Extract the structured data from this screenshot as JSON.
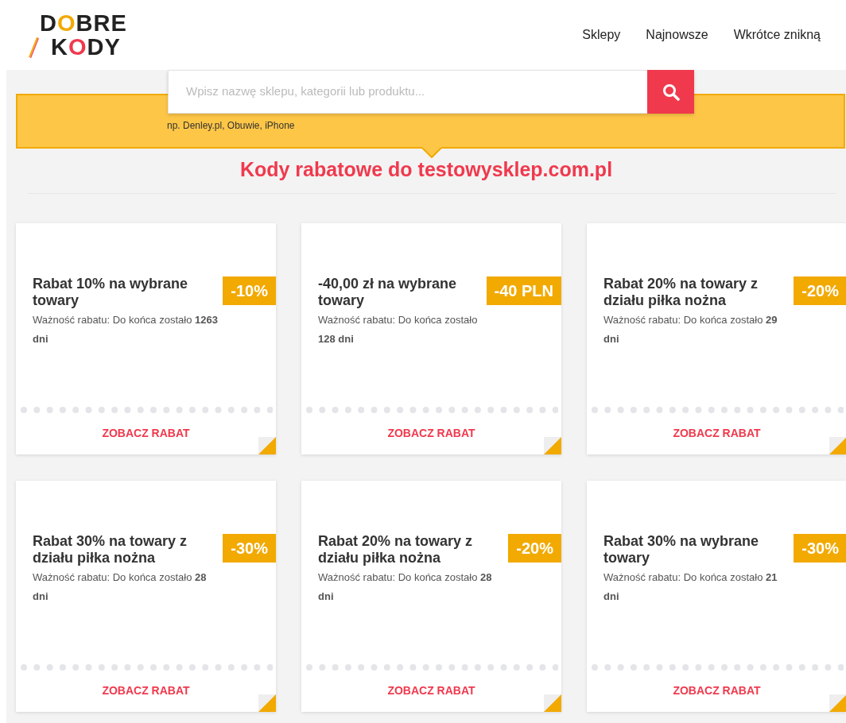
{
  "logo": {
    "lines": [
      [
        {
          "text": "D",
          "color": "#222222"
        },
        {
          "text": "O",
          "color": "#f2a900"
        },
        {
          "text": "BRE",
          "color": "#222222"
        }
      ],
      [
        {
          "text": "K",
          "color": "#222222"
        },
        {
          "text": "O",
          "color": "#f0394d"
        },
        {
          "text": "DY",
          "color": "#222222"
        }
      ]
    ]
  },
  "nav": [
    "Sklepy",
    "Najnowsze",
    "Wkrótce znikną"
  ],
  "search": {
    "placeholder": "Wpisz nazwę sklepu, kategorii lub produktu...",
    "hint": "np. Denley.pl, Obuwie, iPhone"
  },
  "heading": "Kody rabatowe do testowysklep.com.pl",
  "coupons": [
    {
      "title": "Rabat 10% na wybrane towary",
      "badge": "-10%",
      "validity": "Ważność rabatu: Do końca zostało **1263 dni**",
      "button": "ZOBACZ RABAT"
    },
    {
      "title": "-40,00 zł na wybrane towary",
      "badge": "-40 PLN",
      "validity": "Ważność rabatu: Do końca zostało **128 dni**",
      "button": "ZOBACZ RABAT"
    },
    {
      "title": "Rabat 20% na towary z działu piłka nożna",
      "badge": "-20%",
      "validity": "Ważność rabatu: Do końca zostało **29 dni**",
      "button": "ZOBACZ RABAT"
    },
    {
      "title": "Rabat 30% na towary z działu piłka nożna",
      "badge": "-30%",
      "validity": "Ważność rabatu: Do końca zostało **28 dni**",
      "button": "ZOBACZ RABAT"
    },
    {
      "title": "Rabat 20% na towary z działu piłka nożna",
      "badge": "-20%",
      "validity": "Ważność rabatu: Do końca zostało **28 dni**",
      "button": "ZOBACZ RABAT"
    },
    {
      "title": "Rabat 30% na wybrane towary",
      "badge": "-30%",
      "validity": "Ważność rabatu: Do końca zostało **21 dni**",
      "button": "ZOBACZ RABAT"
    }
  ]
}
